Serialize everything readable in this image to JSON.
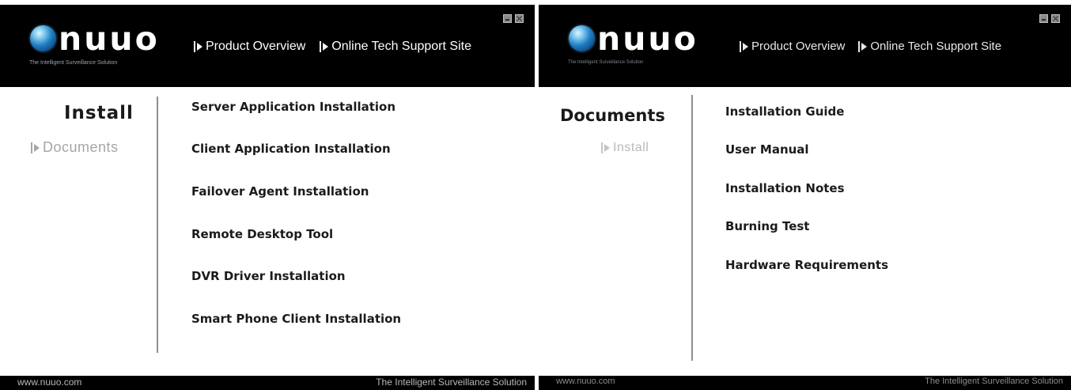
{
  "left_window": {
    "logo": {
      "wordmark": "nuuo",
      "tagline": "The Intelligent Surveillance Solution"
    },
    "nav_links": [
      "Product Overview",
      "Online Tech Support Site"
    ],
    "sidebar": {
      "active": "Install",
      "inactive": "Documents"
    },
    "menu_items": [
      "Server Application Installation",
      "Client Application Installation",
      "Failover Agent Installation",
      "Remote Desktop Tool",
      "DVR Driver Installation",
      "Smart Phone Client Installation"
    ],
    "footer": {
      "url": "www.nuuo.com",
      "tagline": "The Intelligent Surveillance Solution"
    }
  },
  "right_window": {
    "logo": {
      "wordmark": "nuuo",
      "tagline": "The Intelligent Surveillance Solution"
    },
    "nav_links": [
      "Product Overview",
      "Online Tech Support Site"
    ],
    "sidebar": {
      "active": "Documents",
      "inactive": "Install"
    },
    "menu_items": [
      "Installation Guide",
      "User Manual",
      "Installation Notes",
      "Burning Test",
      "Hardware Requirements"
    ],
    "footer": {
      "url": "www.nuuo.com",
      "tagline": "The Intelligent Surveillance Solution"
    }
  },
  "colors": {
    "header_bg": "#000000",
    "content_bg": "#ffffff",
    "active_text": "#1a1a1a",
    "inactive_text": "#a6a6a6",
    "logo_globe": "#1f7fc4"
  }
}
